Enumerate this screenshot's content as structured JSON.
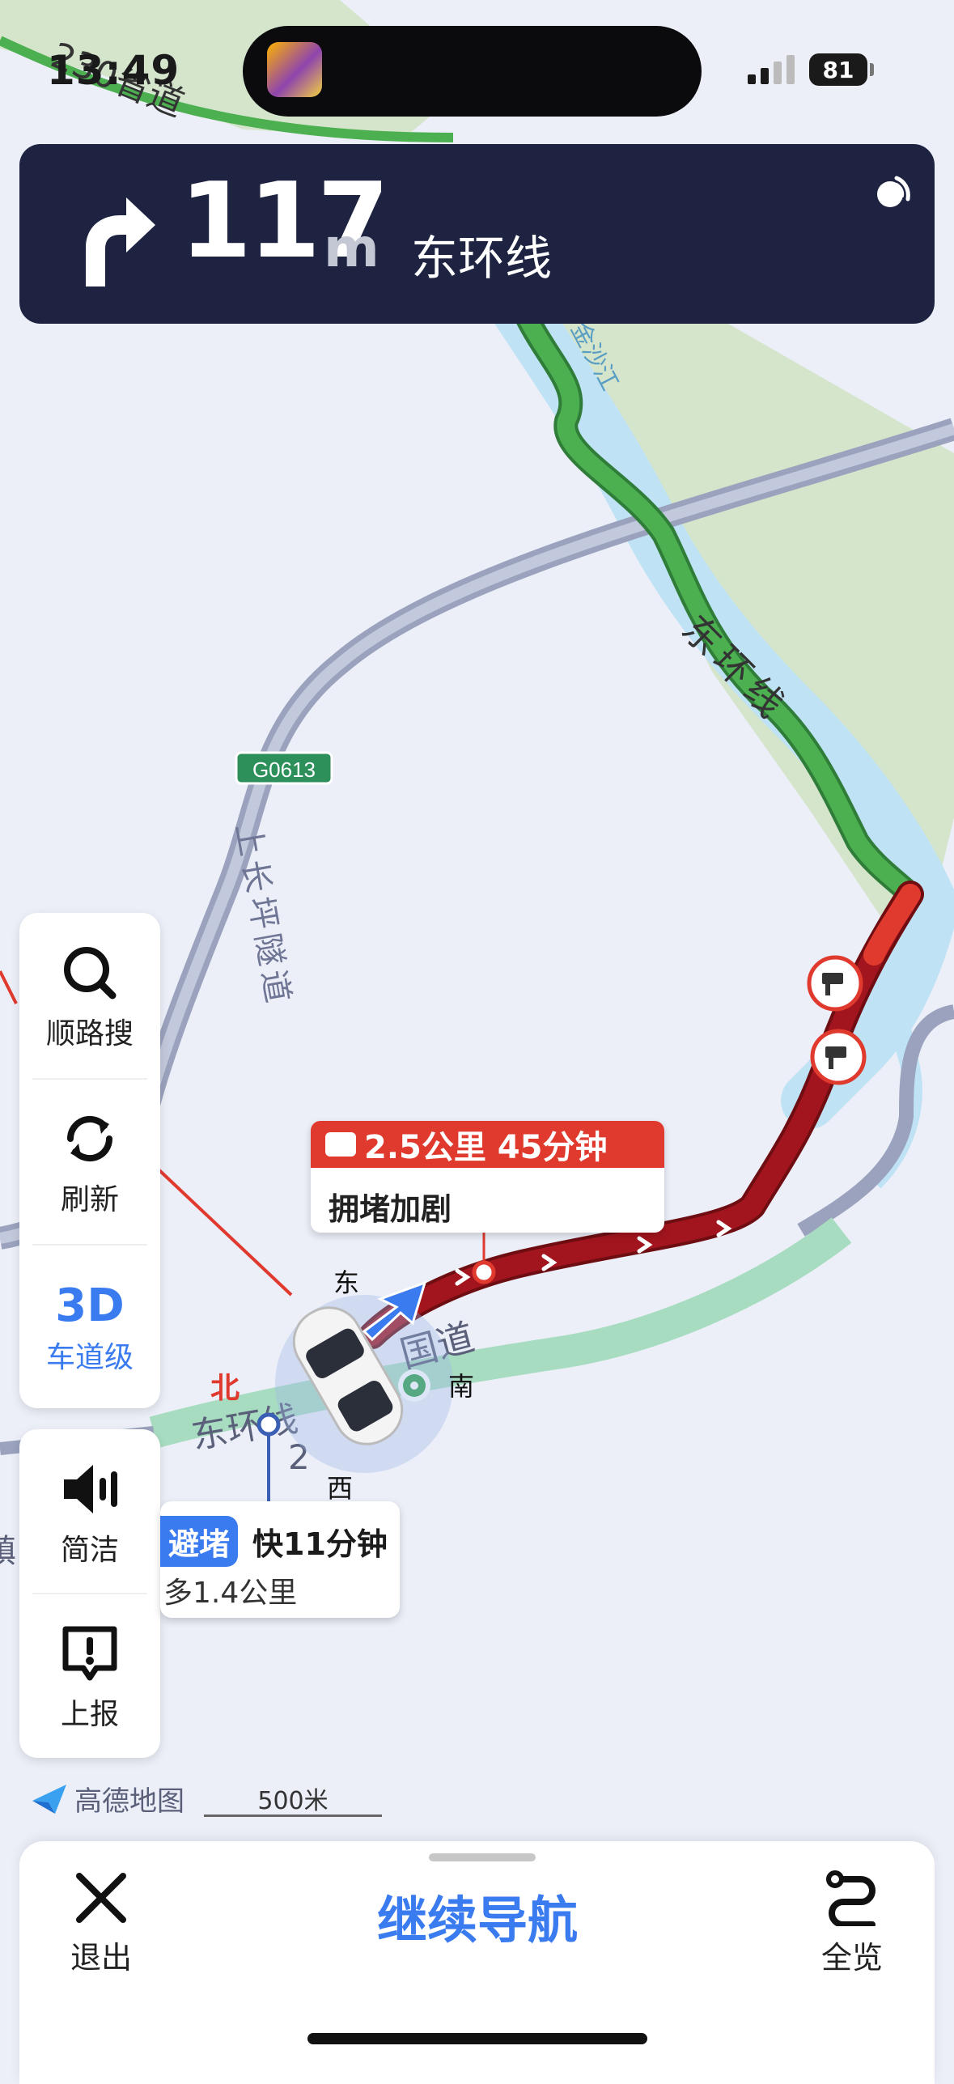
{
  "status_bar": {
    "time": "13:49",
    "battery": "81"
  },
  "guidance": {
    "distance": "117",
    "unit": "m",
    "road": "东环线"
  },
  "map": {
    "labels": {
      "highway_badge": "G0613",
      "tunnel": "上长坪隧道",
      "river": "金沙江",
      "east_ring": "东环线",
      "provincial": "230省道",
      "national": "国道",
      "east_ring_lower": "东环线",
      "lane_number": "2",
      "town_fragment": "镇"
    },
    "compass": {
      "north": "北",
      "east": "东",
      "south": "南",
      "west": "西"
    },
    "colors": {
      "route_clear": "#4caf50",
      "route_jam": "#a3151e",
      "route_slow": "#e0392e",
      "river": "#bfe3f5",
      "land_green": "#d4e5cc",
      "road_gray": "#9aa2bd",
      "primary": "#3a7bf0"
    }
  },
  "side_panel": {
    "along_search": {
      "label": "顺路搜",
      "icon": "search-icon"
    },
    "refresh": {
      "label": "刷新",
      "icon": "refresh-icon"
    },
    "lane_level": {
      "title": "3D",
      "label": "车道级"
    },
    "concise": {
      "label": "简洁",
      "icon": "speaker-icon"
    },
    "report": {
      "label": "上报",
      "icon": "report-icon"
    }
  },
  "jam_callout": {
    "summary": "2.5公里 45分钟",
    "status": "拥堵加剧"
  },
  "avoid_callout": {
    "tag": "避堵",
    "faster": "快11分钟",
    "extra": "多1.4公里"
  },
  "branding": {
    "logo": "高德地图",
    "scale": "500米"
  },
  "bottom_bar": {
    "exit": "退出",
    "continue": "继续导航",
    "overview": "全览"
  }
}
